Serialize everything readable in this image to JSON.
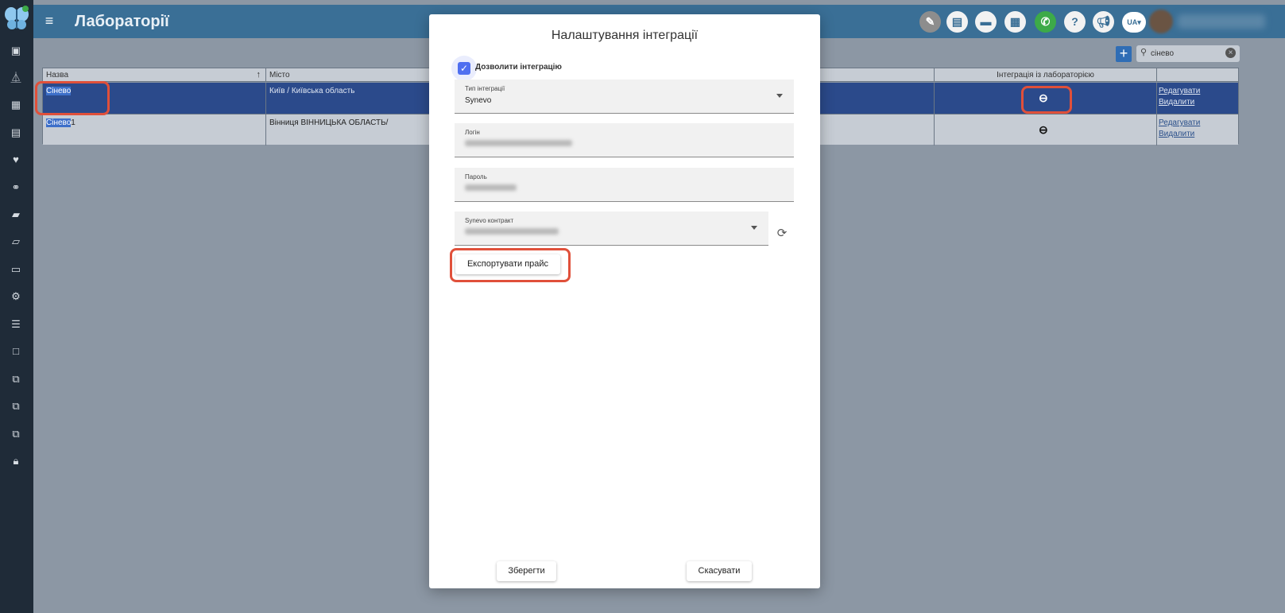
{
  "header": {
    "title": "Лабораторії",
    "language": "UA",
    "icons": [
      "feather-icon",
      "pdf-icon",
      "card-icon",
      "calculator-icon",
      "phone-icon",
      "help-icon",
      "megaphone-icon"
    ],
    "help_glyph": "?"
  },
  "sidebar": {
    "icons": [
      "id-card-icon",
      "flask-icon",
      "calendar-icon",
      "document-icon",
      "heartbeat-icon",
      "users-icon",
      "book-icon",
      "folder-icon",
      "money-icon",
      "cogs-icon",
      "list-icon",
      "note-icon",
      "copy-icon-1",
      "copy-icon-2",
      "copy-icon-3",
      "lock-icon"
    ]
  },
  "search": {
    "value": "сінево"
  },
  "table": {
    "columns": [
      "Назва",
      "Місто",
      "Інтеграція із лабораторією"
    ],
    "rows": [
      {
        "name_highlight": "Сінево",
        "name_rest": "",
        "city": "Київ / Київська область",
        "edit": "Редагувати",
        "delete": "Видалити"
      },
      {
        "name_highlight": "Сінево",
        "name_rest": "1",
        "city": "Вінниця ВІННИЦЬКА ОБЛАСТЬ/",
        "edit": "Редагувати",
        "delete": "Видалити"
      }
    ]
  },
  "modal": {
    "title": "Налаштування інтеграції",
    "allow_label": "Дозволити інтеграцію",
    "allow_checked": true,
    "type_label": "Тип інтеграції",
    "type_value": "Synevo",
    "login_label": "Логін",
    "password_label": "Пароль",
    "contract_label": "Synevo контракт",
    "export_button": "Експортувати прайс",
    "save_button": "Зберегти",
    "cancel_button": "Скасувати"
  }
}
